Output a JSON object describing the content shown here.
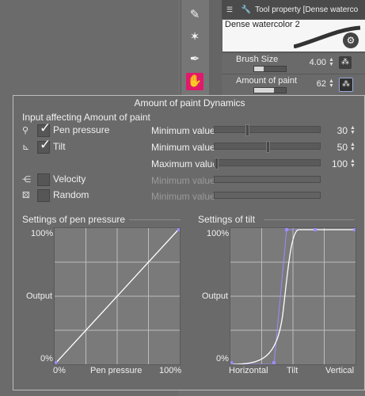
{
  "window": {
    "tool_property_title": "Tool property [Dense waterco",
    "brush_name": "Dense watercolor 2",
    "brush_size_label": "Brush Size",
    "brush_size_value": "4.00",
    "brush_size_fraction": 0.3,
    "amount_label": "Amount of paint",
    "amount_value": "62",
    "amount_fraction": 0.62
  },
  "tools": [
    {
      "icon": "eyedropper-icon",
      "glyph": "✎"
    },
    {
      "icon": "sparkle-icon",
      "glyph": "✶"
    },
    {
      "icon": "pen-nib-icon",
      "glyph": "✒"
    },
    {
      "icon": "fill-hand-icon",
      "glyph": "✋"
    }
  ],
  "dialog": {
    "title": "Amount of paint Dynamics",
    "section_label": "Input affecting Amount of paint",
    "inputs": [
      {
        "name": "Pen pressure",
        "checked": true
      },
      {
        "name": "Tilt",
        "checked": true
      },
      {
        "name": "Velocity",
        "checked": false
      },
      {
        "name": "Random",
        "checked": false
      }
    ],
    "params": [
      {
        "label": "Minimum value",
        "value": "30",
        "enabled": true,
        "fraction": 0.3
      },
      {
        "label": "Minimum value",
        "value": "50",
        "enabled": true,
        "fraction": 0.5
      },
      {
        "label": "Maximum value",
        "value": "100",
        "enabled": true,
        "fraction": 0.0
      },
      {
        "label": "Minimum value",
        "value": "",
        "enabled": false,
        "fraction": 0.0
      },
      {
        "label": "Minimum value",
        "value": "",
        "enabled": false,
        "fraction": 0.0
      }
    ],
    "pressure_graph": {
      "title": "Settings of pen pressure",
      "y_top": "100%",
      "y_mid": "Output",
      "y_bottom": "0%",
      "x_left": "0%",
      "x_mid": "Pen pressure",
      "x_right": "100%"
    },
    "tilt_graph": {
      "title": "Settings of tilt",
      "y_top": "100%",
      "y_mid": "Output",
      "y_bottom": "0%",
      "x_left": "Horizontal",
      "x_mid": "Tilt",
      "x_right": "Vertical"
    }
  },
  "colors": {
    "accent_pink": "#e2186b",
    "handle_purple": "#9b8cff"
  }
}
